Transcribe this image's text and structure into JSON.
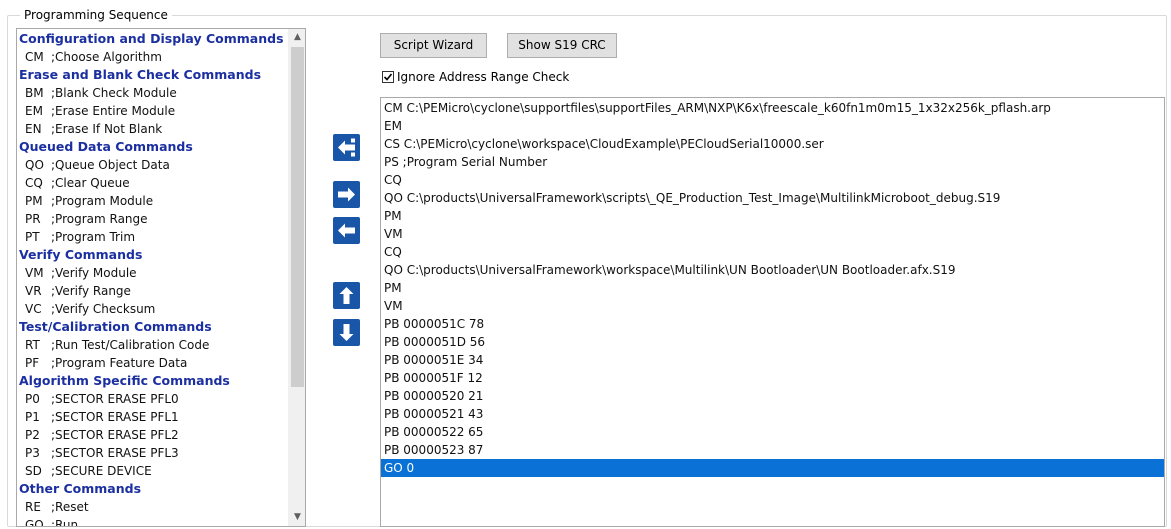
{
  "group": {
    "title": "Programming Sequence"
  },
  "toolbar": {
    "script_wizard": "Script Wizard",
    "show_crc": "Show S19 CRC",
    "ignore_range_label": "Ignore Address Range Check",
    "ignore_range_checked": true
  },
  "commands": [
    {
      "type": "header",
      "label": "Configuration and Display Commands"
    },
    {
      "type": "item",
      "code": "CM",
      "desc": ";Choose Algorithm"
    },
    {
      "type": "header",
      "label": "Erase and Blank Check Commands"
    },
    {
      "type": "item",
      "code": "BM",
      "desc": ";Blank Check Module"
    },
    {
      "type": "item",
      "code": "EM",
      "desc": ";Erase Entire Module"
    },
    {
      "type": "item",
      "code": "EN",
      "desc": ";Erase If Not Blank"
    },
    {
      "type": "header",
      "label": "Queued Data Commands"
    },
    {
      "type": "item",
      "code": "QO",
      "desc": ";Queue Object Data"
    },
    {
      "type": "item",
      "code": "CQ",
      "desc": ";Clear Queue"
    },
    {
      "type": "item",
      "code": "PM",
      "desc": ";Program Module"
    },
    {
      "type": "item",
      "code": "PR",
      "desc": ";Program Range"
    },
    {
      "type": "item",
      "code": "PT",
      "desc": ";Program Trim"
    },
    {
      "type": "header",
      "label": "Verify Commands"
    },
    {
      "type": "item",
      "code": "VM",
      "desc": ";Verify Module"
    },
    {
      "type": "item",
      "code": "VR",
      "desc": ";Verify Range"
    },
    {
      "type": "item",
      "code": "VC",
      "desc": ";Verify Checksum"
    },
    {
      "type": "header",
      "label": "Test/Calibration Commands"
    },
    {
      "type": "item",
      "code": "RT",
      "desc": ";Run Test/Calibration Code"
    },
    {
      "type": "item",
      "code": "PF",
      "desc": ";Program Feature Data"
    },
    {
      "type": "header",
      "label": "Algorithm Specific Commands"
    },
    {
      "type": "item",
      "code": "P0",
      "desc": ";SECTOR ERASE PFL0"
    },
    {
      "type": "item",
      "code": "P1",
      "desc": ";SECTOR ERASE PFL1"
    },
    {
      "type": "item",
      "code": "P2",
      "desc": ";SECTOR ERASE PFL2"
    },
    {
      "type": "item",
      "code": "P3",
      "desc": ";SECTOR ERASE PFL3"
    },
    {
      "type": "item",
      "code": "SD",
      "desc": ";SECURE DEVICE"
    },
    {
      "type": "header",
      "label": "Other Commands"
    },
    {
      "type": "item",
      "code": "RE",
      "desc": ";Reset"
    },
    {
      "type": "item",
      "code": "GO",
      "desc": ";Run"
    }
  ],
  "sequence": [
    {
      "text": "CM  C:\\PEMicro\\cyclone\\supportfiles\\supportFiles_ARM\\NXP\\K6x\\freescale_k60fn1m0m15_1x32x256k_pflash.arp"
    },
    {
      "text": "EM"
    },
    {
      "text": "CS   C:\\PEMicro\\cyclone\\workspace\\CloudExample\\PECloudSerial10000.ser"
    },
    {
      "text": "PS  ;Program Serial Number"
    },
    {
      "text": "CQ"
    },
    {
      "text": "QO  C:\\products\\UniversalFramework\\scripts\\_QE_Production_Test_Image\\MultilinkMicroboot_debug.S19"
    },
    {
      "text": "PM"
    },
    {
      "text": "VM"
    },
    {
      "text": "CQ"
    },
    {
      "text": "QO  C:\\products\\UniversalFramework\\workspace\\Multilink\\UN Bootloader\\UN Bootloader.afx.S19"
    },
    {
      "text": "PM"
    },
    {
      "text": "VM"
    },
    {
      "text": "PB  0000051C 78"
    },
    {
      "text": "PB  0000051D 56"
    },
    {
      "text": "PB  0000051E 34"
    },
    {
      "text": "PB  0000051F 12"
    },
    {
      "text": "PB  00000520 21"
    },
    {
      "text": "PB  00000521 43"
    },
    {
      "text": "PB  00000522 65"
    },
    {
      "text": "PB  00000523 87"
    },
    {
      "text": "GO 0",
      "selected": true
    }
  ],
  "icons": {
    "remove": "remove-from-sequence-icon",
    "add": "add-to-sequence-icon",
    "back": "move-left-icon",
    "up": "move-up-icon",
    "down": "move-down-icon",
    "scroll_up": "scroll-up-icon",
    "scroll_down": "scroll-down-icon"
  },
  "colors": {
    "header_text": "#1b2fa0",
    "arrow_button": "#1a56a8",
    "selection": "#0a72d6"
  }
}
